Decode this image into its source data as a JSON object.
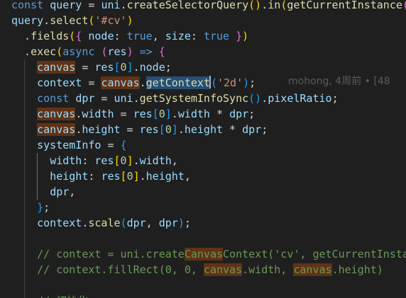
{
  "code_lines": [
    {
      "tokens": [
        {
          "t": "const ",
          "c": "kw"
        },
        {
          "t": "query",
          "c": "var"
        },
        {
          "t": " = ",
          "c": "op"
        },
        {
          "t": "uni",
          "c": "var"
        },
        {
          "t": ".",
          "c": "op"
        },
        {
          "t": "createSelectorQuery",
          "c": "fn"
        },
        {
          "t": "()",
          "c": "br1"
        },
        {
          "t": ".",
          "c": "op"
        },
        {
          "t": "in",
          "c": "fn"
        },
        {
          "t": "(",
          "c": "br1"
        },
        {
          "t": "getCurrentInstance",
          "c": "fn"
        },
        {
          "t": "()",
          "c": "br2"
        },
        {
          "t": ")",
          "c": "br1"
        }
      ]
    },
    {
      "tokens": [
        {
          "t": "query",
          "c": "var"
        },
        {
          "t": ".",
          "c": "op"
        },
        {
          "t": "select",
          "c": "fn"
        },
        {
          "t": "(",
          "c": "br1"
        },
        {
          "t": "'#cv'",
          "c": "str"
        },
        {
          "t": ")",
          "c": "br1"
        }
      ]
    },
    {
      "tokens": [
        {
          "t": "  .",
          "c": "op"
        },
        {
          "t": "fields",
          "c": "fn"
        },
        {
          "t": "(",
          "c": "br1"
        },
        {
          "t": "{",
          "c": "br2"
        },
        {
          "t": " node",
          "c": "var"
        },
        {
          "t": ": ",
          "c": "op"
        },
        {
          "t": "true",
          "c": "kw"
        },
        {
          "t": ", ",
          "c": "op"
        },
        {
          "t": "size",
          "c": "var"
        },
        {
          "t": ": ",
          "c": "op"
        },
        {
          "t": "true",
          "c": "kw"
        },
        {
          "t": " ",
          "c": "op"
        },
        {
          "t": "}",
          "c": "br2"
        },
        {
          "t": ")",
          "c": "br1"
        }
      ]
    },
    {
      "tokens": [
        {
          "t": "  .",
          "c": "op"
        },
        {
          "t": "exec",
          "c": "fn"
        },
        {
          "t": "(",
          "c": "br1"
        },
        {
          "t": "async",
          "c": "kw"
        },
        {
          "t": " ",
          "c": "op"
        },
        {
          "t": "(",
          "c": "br2"
        },
        {
          "t": "res",
          "c": "var"
        },
        {
          "t": ")",
          "c": "br2"
        },
        {
          "t": " ",
          "c": "op"
        },
        {
          "t": "=>",
          "c": "kw"
        },
        {
          "t": " ",
          "c": "op"
        },
        {
          "t": "{",
          "c": "br2"
        }
      ]
    },
    {
      "tokens": [
        {
          "t": "    ",
          "c": "op"
        },
        {
          "t": "canvas",
          "c": "var",
          "h": "hl"
        },
        {
          "t": " = ",
          "c": "op"
        },
        {
          "t": "res",
          "c": "var"
        },
        {
          "t": "[",
          "c": "br3"
        },
        {
          "t": "0",
          "c": "num"
        },
        {
          "t": "]",
          "c": "br3"
        },
        {
          "t": ".",
          "c": "op"
        },
        {
          "t": "node",
          "c": "var"
        },
        {
          "t": ";",
          "c": "op"
        }
      ]
    },
    {
      "tokens": [
        {
          "t": "    ",
          "c": "op"
        },
        {
          "t": "context",
          "c": "var"
        },
        {
          "t": " = ",
          "c": "op"
        },
        {
          "t": "canvas",
          "c": "var",
          "h": "hl"
        },
        {
          "t": ".",
          "c": "op"
        },
        {
          "t": "getContext",
          "c": "fn",
          "h": "sel",
          "cursor": true
        },
        {
          "t": "(",
          "c": "br3"
        },
        {
          "t": "'2d'",
          "c": "str"
        },
        {
          "t": ")",
          "c": "br3"
        },
        {
          "t": ";",
          "c": "op"
        }
      ]
    },
    {
      "tokens": [
        {
          "t": "    ",
          "c": "op"
        },
        {
          "t": "const",
          "c": "kw"
        },
        {
          "t": " ",
          "c": "op"
        },
        {
          "t": "dpr",
          "c": "var"
        },
        {
          "t": " = ",
          "c": "op"
        },
        {
          "t": "uni",
          "c": "var"
        },
        {
          "t": ".",
          "c": "op"
        },
        {
          "t": "getSystemInfoSync",
          "c": "fn"
        },
        {
          "t": "()",
          "c": "br3"
        },
        {
          "t": ".",
          "c": "op"
        },
        {
          "t": "pixelRatio",
          "c": "var"
        },
        {
          "t": ";",
          "c": "op"
        }
      ]
    },
    {
      "tokens": [
        {
          "t": "    ",
          "c": "op"
        },
        {
          "t": "canvas",
          "c": "var",
          "h": "hl"
        },
        {
          "t": ".",
          "c": "op"
        },
        {
          "t": "width",
          "c": "var"
        },
        {
          "t": " = ",
          "c": "op"
        },
        {
          "t": "res",
          "c": "var"
        },
        {
          "t": "[",
          "c": "br3"
        },
        {
          "t": "0",
          "c": "num"
        },
        {
          "t": "]",
          "c": "br3"
        },
        {
          "t": ".",
          "c": "op"
        },
        {
          "t": "width",
          "c": "var"
        },
        {
          "t": " * ",
          "c": "op"
        },
        {
          "t": "dpr",
          "c": "var"
        },
        {
          "t": ";",
          "c": "op"
        }
      ]
    },
    {
      "tokens": [
        {
          "t": "    ",
          "c": "op"
        },
        {
          "t": "canvas",
          "c": "var",
          "h": "hl"
        },
        {
          "t": ".",
          "c": "op"
        },
        {
          "t": "height",
          "c": "var"
        },
        {
          "t": " = ",
          "c": "op"
        },
        {
          "t": "res",
          "c": "var"
        },
        {
          "t": "[",
          "c": "br3"
        },
        {
          "t": "0",
          "c": "num"
        },
        {
          "t": "]",
          "c": "br3"
        },
        {
          "t": ".",
          "c": "op"
        },
        {
          "t": "height",
          "c": "var"
        },
        {
          "t": " * ",
          "c": "op"
        },
        {
          "t": "dpr",
          "c": "var"
        },
        {
          "t": ";",
          "c": "op"
        }
      ]
    },
    {
      "tokens": [
        {
          "t": "    ",
          "c": "op"
        },
        {
          "t": "systemInfo",
          "c": "var"
        },
        {
          "t": " = ",
          "c": "op"
        },
        {
          "t": "{",
          "c": "br3"
        }
      ]
    },
    {
      "tokens": [
        {
          "t": "      ",
          "c": "op"
        },
        {
          "t": "width",
          "c": "var"
        },
        {
          "t": ": ",
          "c": "op"
        },
        {
          "t": "res",
          "c": "var"
        },
        {
          "t": "[",
          "c": "br1"
        },
        {
          "t": "0",
          "c": "num"
        },
        {
          "t": "]",
          "c": "br1"
        },
        {
          "t": ".",
          "c": "op"
        },
        {
          "t": "width",
          "c": "var"
        },
        {
          "t": ",",
          "c": "op"
        }
      ]
    },
    {
      "tokens": [
        {
          "t": "      ",
          "c": "op"
        },
        {
          "t": "height",
          "c": "var"
        },
        {
          "t": ": ",
          "c": "op"
        },
        {
          "t": "res",
          "c": "var"
        },
        {
          "t": "[",
          "c": "br1"
        },
        {
          "t": "0",
          "c": "num"
        },
        {
          "t": "]",
          "c": "br1"
        },
        {
          "t": ".",
          "c": "op"
        },
        {
          "t": "height",
          "c": "var"
        },
        {
          "t": ",",
          "c": "op"
        }
      ]
    },
    {
      "tokens": [
        {
          "t": "      ",
          "c": "op"
        },
        {
          "t": "dpr",
          "c": "var"
        },
        {
          "t": ",",
          "c": "op"
        }
      ]
    },
    {
      "tokens": [
        {
          "t": "    ",
          "c": "op"
        },
        {
          "t": "}",
          "c": "br3"
        },
        {
          "t": ";",
          "c": "op"
        }
      ]
    },
    {
      "tokens": [
        {
          "t": "    ",
          "c": "op"
        },
        {
          "t": "context",
          "c": "var"
        },
        {
          "t": ".",
          "c": "op"
        },
        {
          "t": "scale",
          "c": "fn"
        },
        {
          "t": "(",
          "c": "br3"
        },
        {
          "t": "dpr",
          "c": "var"
        },
        {
          "t": ", ",
          "c": "op"
        },
        {
          "t": "dpr",
          "c": "var"
        },
        {
          "t": ")",
          "c": "br3"
        },
        {
          "t": ";",
          "c": "op"
        }
      ]
    },
    {
      "tokens": []
    },
    {
      "tokens": [
        {
          "t": "    ",
          "c": "op"
        },
        {
          "t": "// context = uni.create",
          "c": "cm"
        },
        {
          "t": "Canvas",
          "c": "cm",
          "h": "hl"
        },
        {
          "t": "Context('cv', getCurrentInstance",
          "c": "cm"
        }
      ]
    },
    {
      "tokens": [
        {
          "t": "    ",
          "c": "op"
        },
        {
          "t": "// context.fillRect(0, 0, ",
          "c": "cm"
        },
        {
          "t": "canvas",
          "c": "cm",
          "h": "hl"
        },
        {
          "t": ".width, ",
          "c": "cm"
        },
        {
          "t": "canvas",
          "c": "cm",
          "h": "hl"
        },
        {
          "t": ".height)",
          "c": "cm"
        }
      ]
    },
    {
      "tokens": []
    },
    {
      "tokens": [
        {
          "t": "    ",
          "c": "op"
        },
        {
          "t": "// 初始化",
          "c": "cm"
        }
      ]
    }
  ],
  "blame_annotation": "mohong, 4周前 • [48",
  "colors": {
    "background": "#1f1f1f",
    "keyword": "#569cd6",
    "function": "#dcdcaa",
    "variable": "#9cdcfe",
    "string": "#ce9178",
    "number": "#b5cea8",
    "comment": "#6a9955",
    "highlight": "#613214",
    "selection": "#264f78"
  }
}
